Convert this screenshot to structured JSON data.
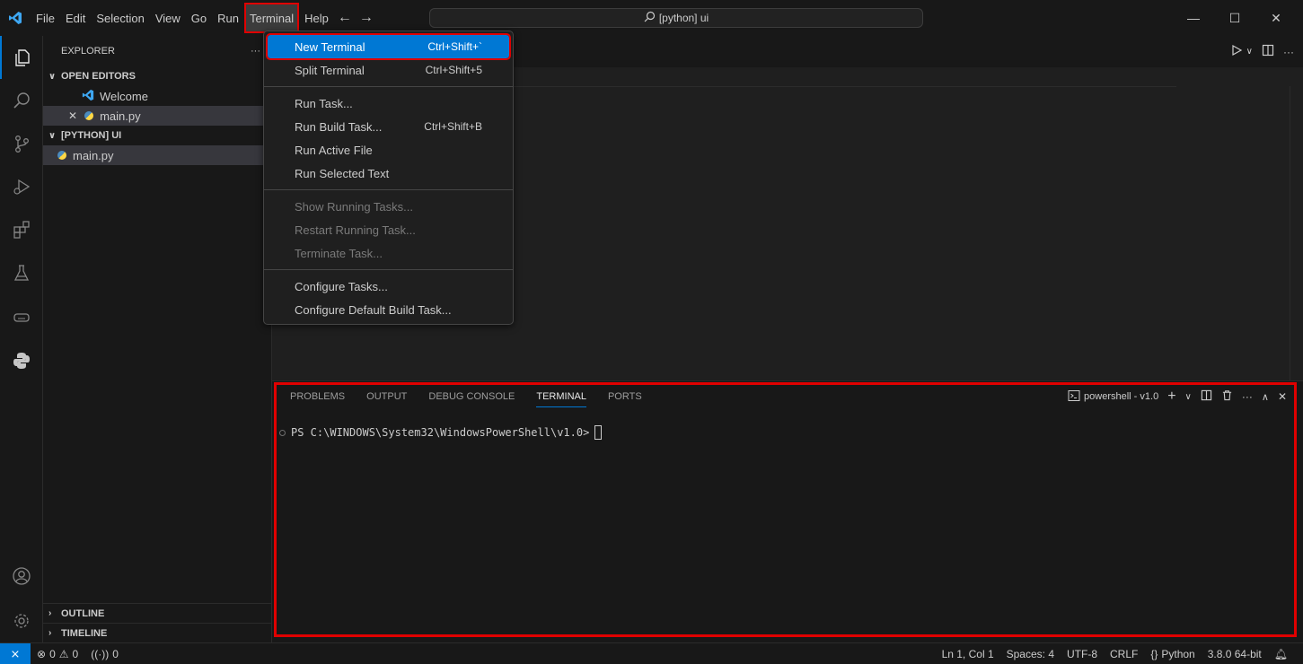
{
  "titlebar": {
    "menus": [
      "File",
      "Edit",
      "Selection",
      "View",
      "Go",
      "Run",
      "Terminal",
      "Help"
    ],
    "active_menu": "Terminal",
    "search_text": "[python] ui"
  },
  "sidebar": {
    "title": "EXPLORER",
    "open_editors_label": "OPEN EDITORS",
    "open_editors": [
      "Welcome",
      "main.py"
    ],
    "folder_label": "[PYTHON] UI",
    "files": [
      "main.py"
    ],
    "outline_label": "OUTLINE",
    "timeline_label": "TIMELINE"
  },
  "terminal_menu": {
    "items": [
      {
        "label": "New Terminal",
        "shortcut": "Ctrl+Shift+`"
      },
      {
        "label": "Split Terminal",
        "shortcut": "Ctrl+Shift+5"
      },
      {
        "label": "Run Task...",
        "shortcut": ""
      },
      {
        "label": "Run Build Task...",
        "shortcut": "Ctrl+Shift+B"
      },
      {
        "label": "Run Active File",
        "shortcut": ""
      },
      {
        "label": "Run Selected Text",
        "shortcut": ""
      },
      {
        "label": "Show Running Tasks...",
        "shortcut": ""
      },
      {
        "label": "Restart Running Task...",
        "shortcut": ""
      },
      {
        "label": "Terminate Task...",
        "shortcut": ""
      },
      {
        "label": "Configure Tasks...",
        "shortcut": ""
      },
      {
        "label": "Configure Default Build Task...",
        "shortcut": ""
      }
    ]
  },
  "panel": {
    "tabs": [
      "PROBLEMS",
      "OUTPUT",
      "DEBUG CONSOLE",
      "TERMINAL",
      "PORTS"
    ],
    "active_tab": "TERMINAL",
    "shell_label": "powershell - v1.0",
    "prompt": "PS C:\\WINDOWS\\System32\\WindowsPowerShell\\v1.0>"
  },
  "statusbar": {
    "errors": "0",
    "warnings": "0",
    "ports": "0",
    "position": "Ln 1, Col 1",
    "spaces": "Spaces: 4",
    "encoding": "UTF-8",
    "eol": "CRLF",
    "language": "Python",
    "interpreter": "3.8.0 64-bit"
  },
  "colors": {
    "accent": "#0078d4",
    "highlight_box": "#e00000",
    "background": "#1f1f1f"
  }
}
